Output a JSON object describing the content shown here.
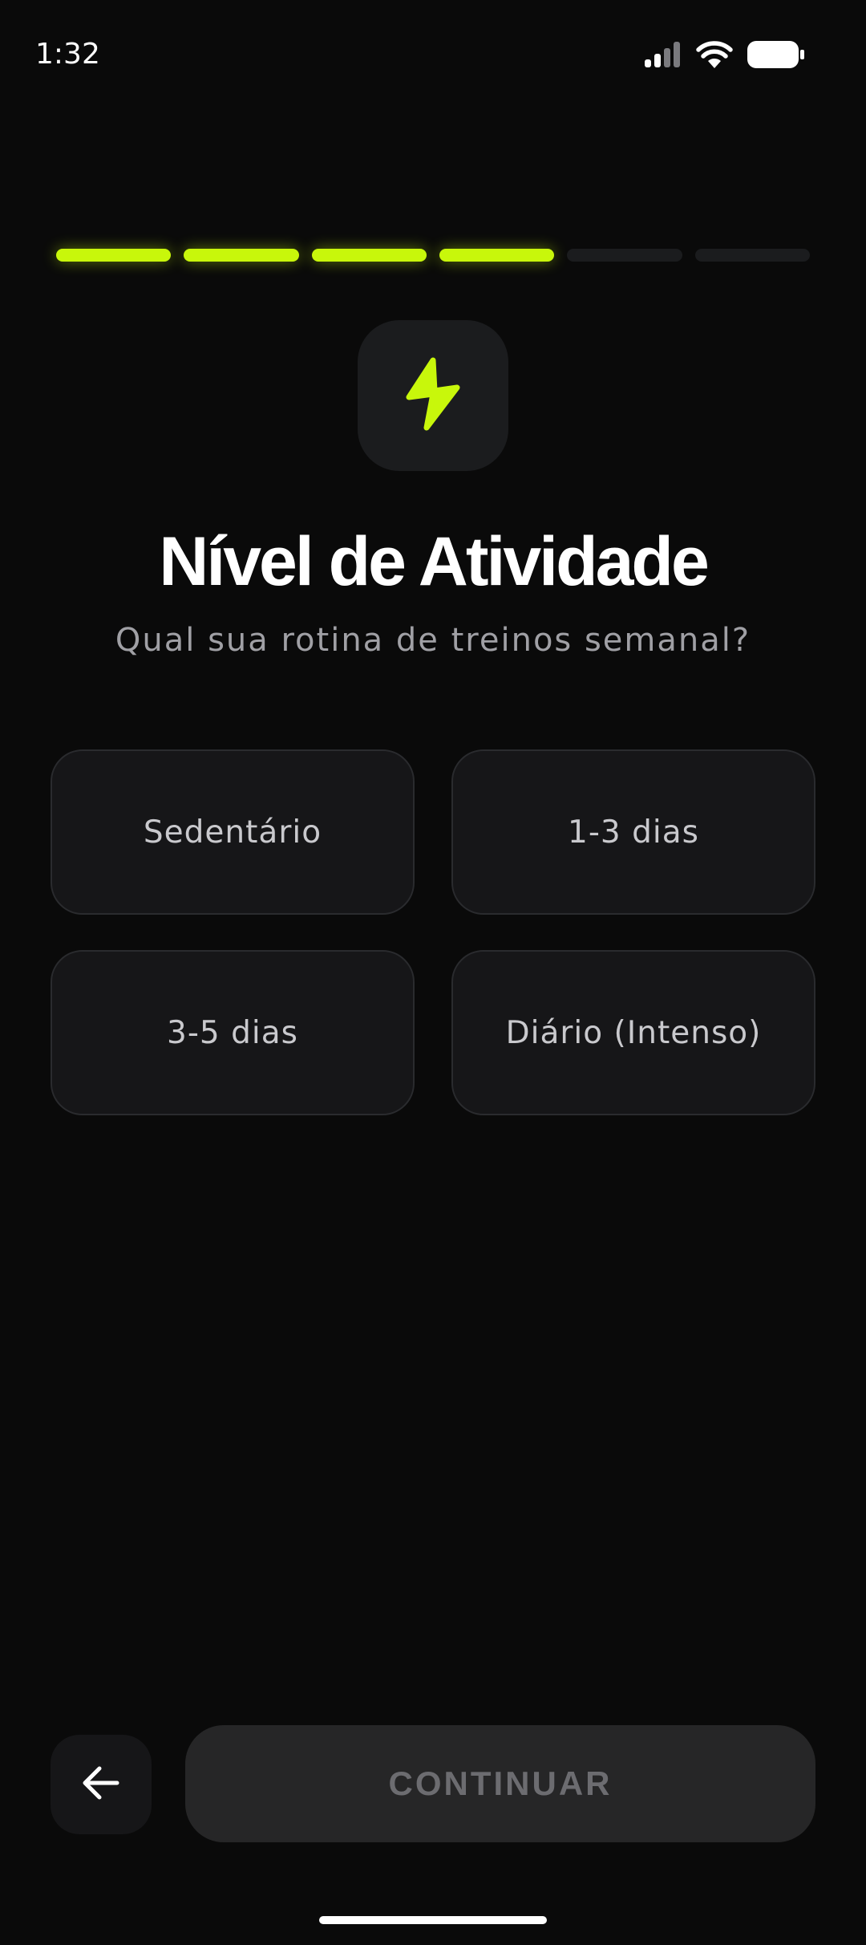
{
  "status_bar": {
    "time": "1:32",
    "signal_icon": "cellular-signal-icon",
    "wifi_icon": "wifi-icon",
    "battery_icon": "battery-icon"
  },
  "progress": {
    "total_steps": 6,
    "completed_steps": 4,
    "accent_color": "#c8f70b"
  },
  "header": {
    "icon": "lightning-bolt-icon",
    "title": "Nível de Atividade",
    "subtitle": "Qual sua rotina de treinos semanal?"
  },
  "options": [
    {
      "label": "Sedentário"
    },
    {
      "label": "1-3 dias"
    },
    {
      "label": "3-5 dias"
    },
    {
      "label": "Diário (Intenso)"
    }
  ],
  "footer": {
    "back_icon": "arrow-left-icon",
    "continue_label": "CONTINUAR"
  }
}
